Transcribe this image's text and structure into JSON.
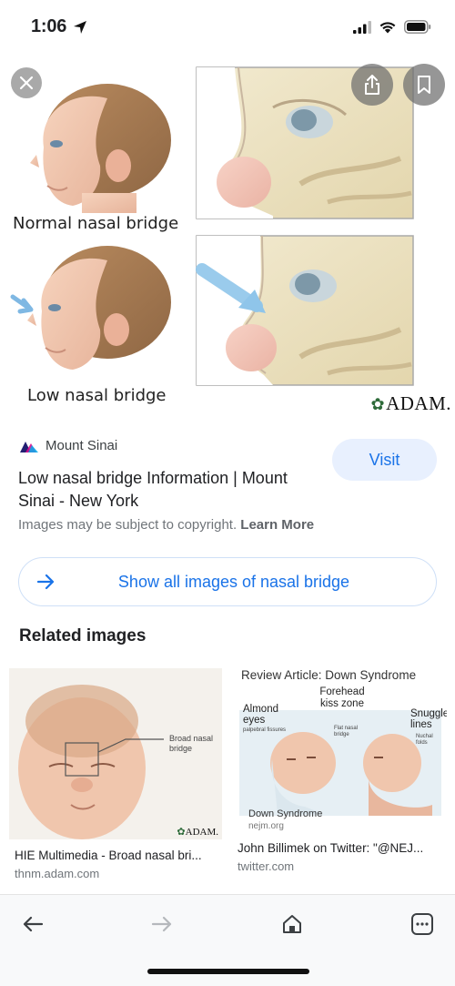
{
  "status_bar": {
    "time": "1:06"
  },
  "hero": {
    "caption_top": "Normal nasal bridge",
    "caption_bottom": "Low nasal bridge",
    "logo_text": "ADAM."
  },
  "result": {
    "source": "Mount Sinai",
    "visit_label": "Visit",
    "title": "Low nasal bridge Information | Mount Sinai - New York",
    "copyright_text": "Images may be subject to copyright.",
    "learn_more": "Learn More"
  },
  "show_all": {
    "label": "Show all images of nasal bridge"
  },
  "related": {
    "heading": "Related images",
    "items": [
      {
        "caption": "HIE Multimedia - Broad nasal bri...",
        "domain": "thnm.adam.com",
        "image_label": "Broad nasal bridge",
        "image_logo": "ADAM."
      },
      {
        "caption": "John Billimek on Twitter: \"@NEJ...",
        "domain": "twitter.com",
        "image_title": "Review Article: Down Syndrome",
        "label_almond": "Almond eyes",
        "label_palpebral": "palpebral fissures",
        "label_forehead": "Forehead kiss zone",
        "label_flat": "Flat nasal bridge",
        "label_snuggle": "Snuggle lines",
        "label_nuchal": "Nuchal folds",
        "image_footer": "Down Syndrome",
        "image_source": "nejm.org"
      }
    ]
  },
  "colors": {
    "accent": "#1a73e8",
    "visit_bg": "#e8f0fe",
    "muted": "#70757a"
  }
}
